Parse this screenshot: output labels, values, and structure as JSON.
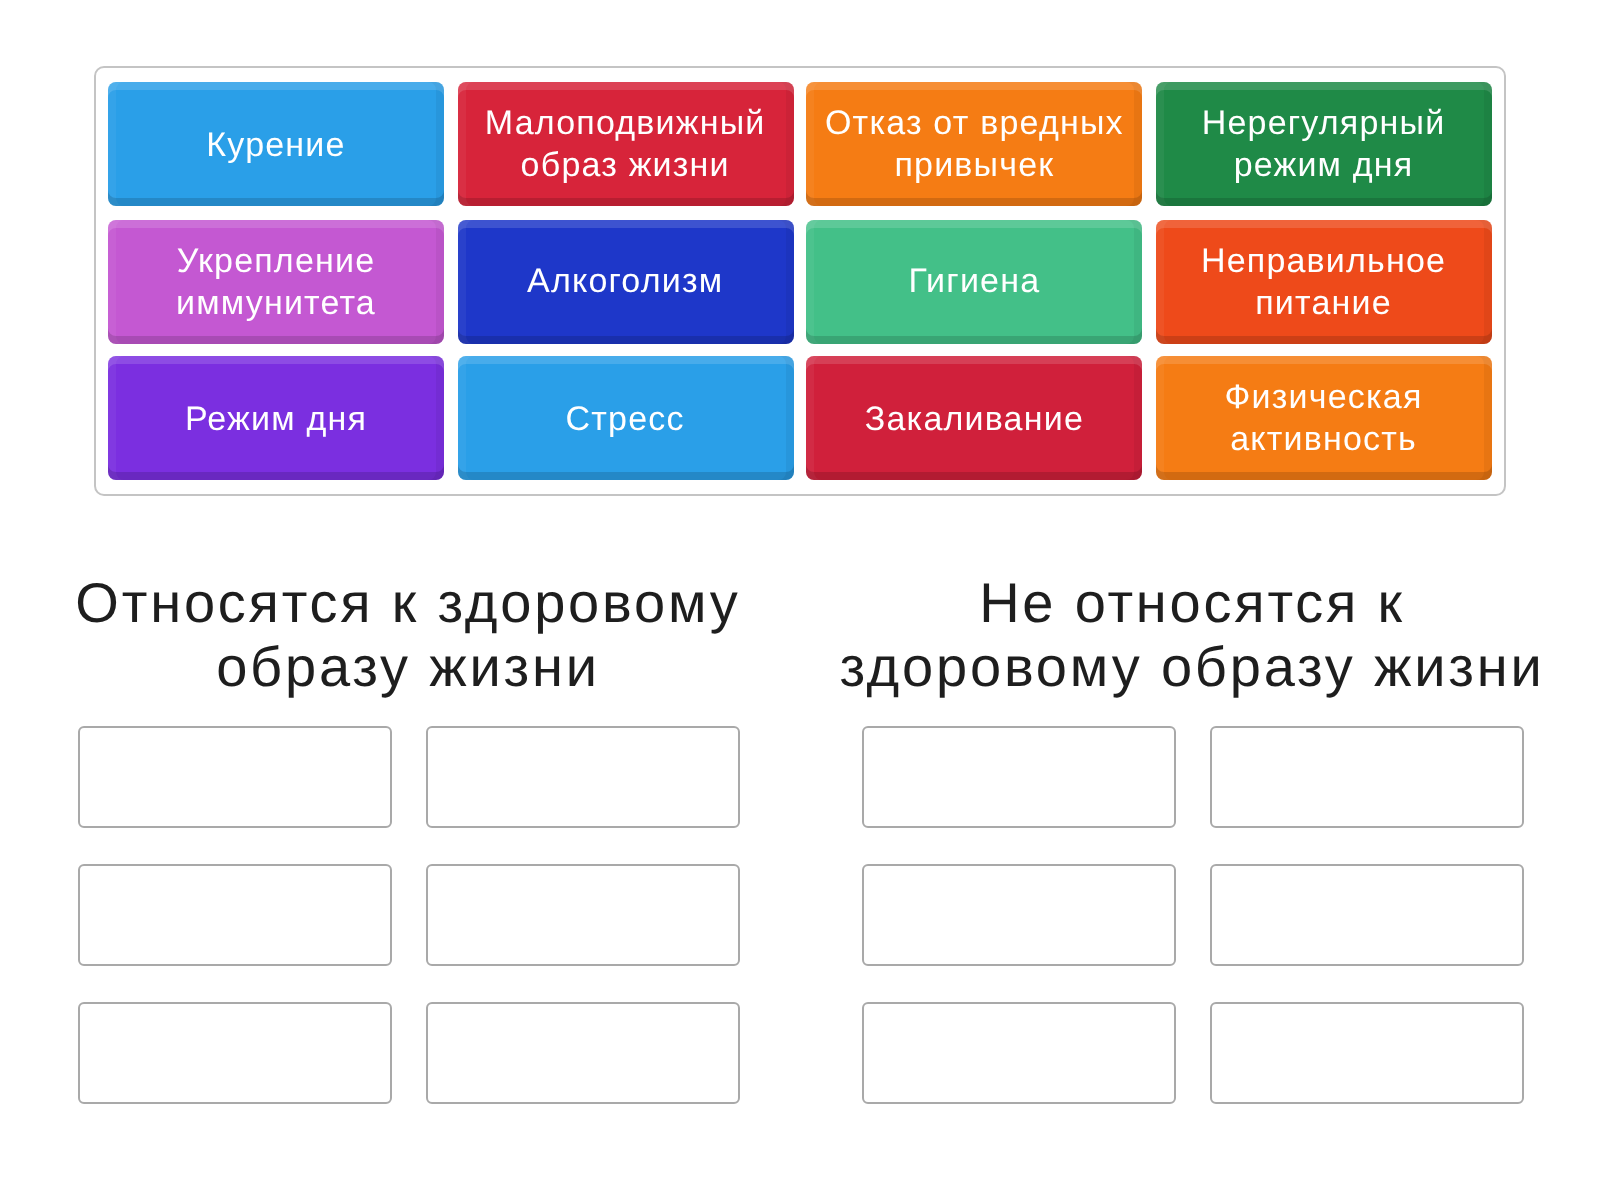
{
  "tiles": [
    {
      "text": "Курение",
      "color": "#2a9fe8"
    },
    {
      "text": "Малоподвижный образ жизни",
      "color": "#d7243a"
    },
    {
      "text": "Отказ от вредных привычек",
      "color": "#f57c14"
    },
    {
      "text": "Нерегулярный режим дня",
      "color": "#1f8a47"
    },
    {
      "text": "Укрепление иммунитета",
      "color": "#c458d2"
    },
    {
      "text": "Алкоголизм",
      "color": "#1e37c9"
    },
    {
      "text": "Гигиена",
      "color": "#43c088"
    },
    {
      "text": "Неправильное питание",
      "color": "#ee4a1a"
    },
    {
      "text": "Режим дня",
      "color": "#7b2fe0"
    },
    {
      "text": "Стресс",
      "color": "#2a9fe8"
    },
    {
      "text": "Закаливание",
      "color": "#d0203b"
    },
    {
      "text": "Физическая активность",
      "color": "#f57c14"
    }
  ],
  "groups": [
    {
      "title": "Относятся к здоровому образу жизни"
    },
    {
      "title": "Не относятся к здоровому образу жизни"
    }
  ]
}
